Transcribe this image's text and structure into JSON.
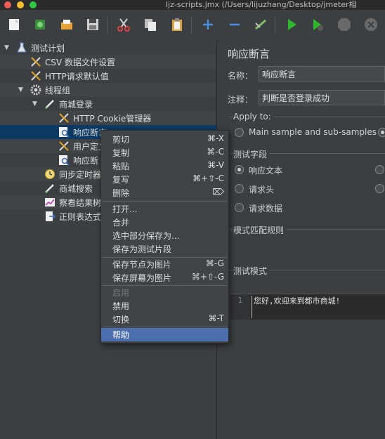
{
  "window": {
    "title": "ljz-scripts.jmx (/Users/lijuzhang/Desktop/jmeter相"
  },
  "toolbar": {
    "buttons": [
      "new-icon",
      "templates-icon",
      "open-icon",
      "save-icon",
      "cut-icon",
      "copy-icon",
      "paste-icon",
      "expand-icon",
      "collapse-icon",
      "toggle-icon",
      "start-icon",
      "start-no-pauses-icon",
      "stop-icon",
      "shutdown-icon"
    ]
  },
  "tree": {
    "items": [
      {
        "label": "测试计划",
        "icon": "flask-icon"
      },
      {
        "label": "CSV 数据文件设置",
        "icon": "config-tools-icon"
      },
      {
        "label": "HTTP请求默认值",
        "icon": "config-tools-icon"
      },
      {
        "label": "线程组",
        "icon": "gear-icon"
      },
      {
        "label": "商城登录",
        "icon": "sampler-pen-icon"
      },
      {
        "label": "HTTP Cookie管理器",
        "icon": "config-tools-icon"
      },
      {
        "label": "响应断言",
        "icon": "assertion-magnifier-icon"
      },
      {
        "label": "用户定义",
        "icon": "config-tools-icon"
      },
      {
        "label": "响应断",
        "icon": "assertion-magnifier-icon"
      },
      {
        "label": "同步定时器",
        "icon": "timer-icon"
      },
      {
        "label": "商城搜索",
        "icon": "sampler-pen-icon"
      },
      {
        "label": "察看结果树",
        "icon": "listener-chart-icon"
      },
      {
        "label": "正则表达式",
        "icon": "extractor-icon"
      }
    ]
  },
  "panel": {
    "title": "响应断言",
    "name_label": "名称：",
    "name_value": "响应断言",
    "comment_label": "注释：",
    "comment_value": "判断是否登录成功",
    "apply_to_label": "Apply to:",
    "apply_to_option": "Main sample and sub-samples",
    "field_section": "测试字段",
    "field_options": [
      "响应文本",
      "请求头",
      "请求数据"
    ],
    "match_section": "模式匹配规则",
    "pattern_section": "测试模式",
    "editor_line": "1",
    "editor_text": "您好,欢迎来到都市商城!"
  },
  "context_menu": {
    "items": [
      {
        "label": "剪切",
        "shortcut": "⌘-X"
      },
      {
        "label": "复制",
        "shortcut": "⌘-C"
      },
      {
        "label": "粘贴",
        "shortcut": "⌘-V"
      },
      {
        "label": "复写",
        "shortcut": "⌘+⇧-C"
      },
      {
        "label": "删除",
        "shortcut": "⌦"
      },
      {
        "label": "打开...",
        "shortcut": ""
      },
      {
        "label": "合并",
        "shortcut": ""
      },
      {
        "label": "选中部分保存为...",
        "shortcut": ""
      },
      {
        "label": "保存为测试片段",
        "shortcut": ""
      },
      {
        "label": "保存节点为图片",
        "shortcut": "⌘-G"
      },
      {
        "label": "保存屏幕为图片",
        "shortcut": "⌘+⇧-G"
      },
      {
        "label": "启用",
        "shortcut": ""
      },
      {
        "label": "禁用",
        "shortcut": ""
      },
      {
        "label": "切换",
        "shortcut": "⌘-T"
      },
      {
        "label": "帮助",
        "shortcut": ""
      }
    ]
  }
}
